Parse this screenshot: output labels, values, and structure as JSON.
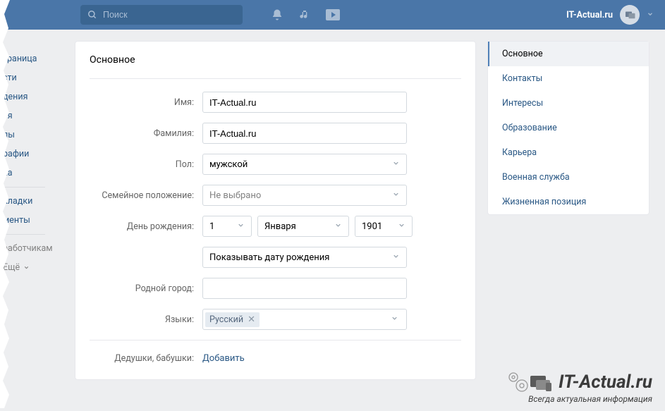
{
  "header": {
    "search_placeholder": "Поиск",
    "username": "IT-Actual.ru"
  },
  "left_nav": {
    "items": [
      "траница",
      "сти",
      "дения",
      "ья",
      "пы",
      "рафии",
      "ка"
    ],
    "items2": [
      "кладки",
      "менты"
    ],
    "items3": [
      "работчикам"
    ],
    "more": "Ещё"
  },
  "form": {
    "title": "Основное",
    "labels": {
      "first_name": "Имя:",
      "last_name": "Фамилия:",
      "sex": "Пол:",
      "relationship": "Семейное положение:",
      "birthday": "День рождения:",
      "hometown": "Родной город:",
      "languages": "Языки:",
      "grandparents": "Дедушки, бабушки:"
    },
    "values": {
      "first_name": "IT-Actual.ru",
      "last_name": "IT-Actual.ru",
      "sex": "мужской",
      "relationship": "Не выбрано",
      "bday_day": "1",
      "bday_month": "Января",
      "bday_year": "1901",
      "bday_display": "Показывать дату рождения",
      "hometown": "",
      "lang_tag": "Русский",
      "add_link": "Добавить"
    }
  },
  "side_nav": {
    "items": [
      {
        "label": "Основное",
        "active": true
      },
      {
        "label": "Контакты",
        "active": false
      },
      {
        "label": "Интересы",
        "active": false
      },
      {
        "label": "Образование",
        "active": false
      },
      {
        "label": "Карьера",
        "active": false
      },
      {
        "label": "Военная служба",
        "active": false
      },
      {
        "label": "Жизненная позиция",
        "active": false
      }
    ]
  },
  "watermark": {
    "title": "IT-Actual.ru",
    "subtitle": "Всегда актуальная информация"
  }
}
